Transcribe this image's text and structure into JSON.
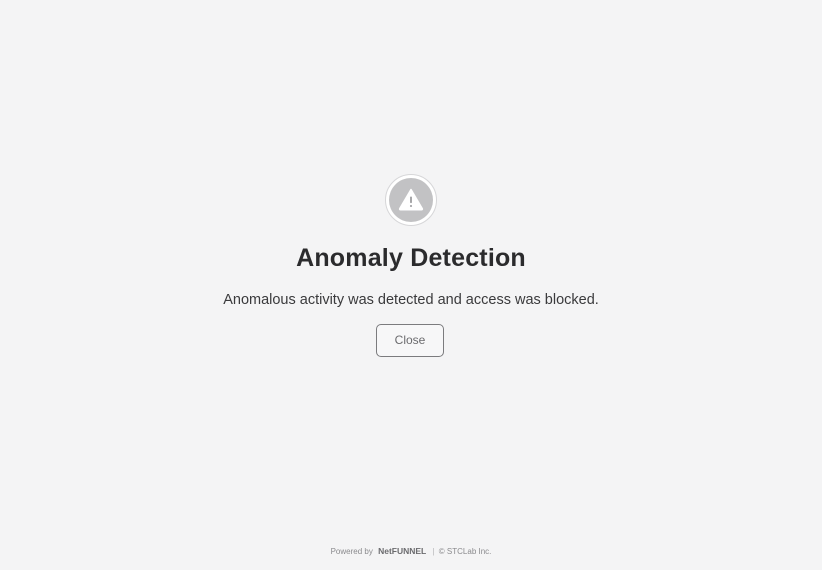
{
  "dialog": {
    "icon": "warning-triangle-icon",
    "title": "Anomaly Detection",
    "message": "Anomalous activity was detected and access was blocked.",
    "close_label": "Close"
  },
  "footer": {
    "powered_by": "Powered by",
    "brand": "NetFUNNEL",
    "separator": "|",
    "copyright": "© STCLab Inc."
  },
  "colors": {
    "background": "#f4f4f5",
    "icon_circle": "#c2c2c4",
    "title": "#2b2b2d"
  }
}
